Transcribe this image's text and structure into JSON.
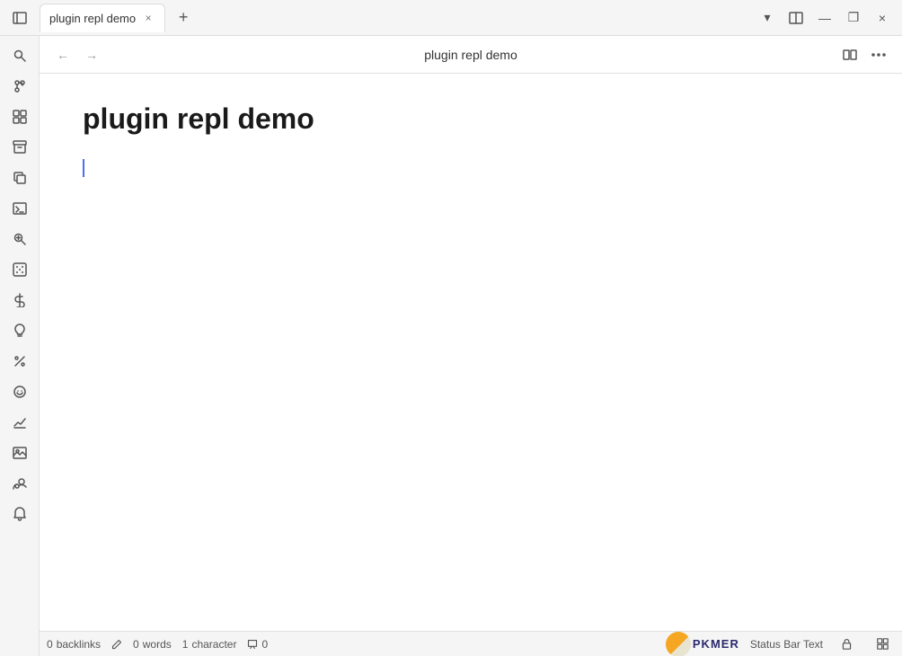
{
  "titleBar": {
    "tab_label": "plugin repl demo",
    "close_label": "×",
    "new_tab_label": "+",
    "sidebar_toggle_icon": "sidebar-icon",
    "dropdown_icon": "▾",
    "split_icon": "⊞",
    "minimize_icon": "—",
    "restore_icon": "❐",
    "window_close_icon": "×"
  },
  "toolbar": {
    "back_icon": "←",
    "forward_icon": "→",
    "title": "plugin repl demo",
    "read_mode_icon": "□□",
    "more_icon": "⋯"
  },
  "sidebar": {
    "icons": [
      {
        "name": "sidebar-item-search",
        "glyph": "🔍",
        "label": "Search"
      },
      {
        "name": "sidebar-item-git",
        "glyph": "⎇",
        "label": "Git"
      },
      {
        "name": "sidebar-item-blocks",
        "glyph": "⊞",
        "label": "Blocks"
      },
      {
        "name": "sidebar-item-archive",
        "glyph": "🗃",
        "label": "Archive"
      },
      {
        "name": "sidebar-item-copy",
        "glyph": "⧉",
        "label": "Copy"
      },
      {
        "name": "sidebar-item-terminal",
        "glyph": ">_",
        "label": "Terminal"
      },
      {
        "name": "sidebar-item-search2",
        "glyph": "🔍",
        "label": "Search2"
      },
      {
        "name": "sidebar-item-dice",
        "glyph": "🎲",
        "label": "Dice"
      },
      {
        "name": "sidebar-item-dollar",
        "glyph": "$",
        "label": "Dollar"
      },
      {
        "name": "sidebar-item-bulb",
        "glyph": "💡",
        "label": "Bulb"
      },
      {
        "name": "sidebar-item-percent",
        "glyph": "<%",
        "label": "Percent"
      },
      {
        "name": "sidebar-item-emoji",
        "glyph": "☺",
        "label": "Emoji"
      },
      {
        "name": "sidebar-item-chart",
        "glyph": "📈",
        "label": "Chart"
      },
      {
        "name": "sidebar-item-image",
        "glyph": "🖼",
        "label": "Image"
      },
      {
        "name": "sidebar-item-user",
        "glyph": "👤",
        "label": "User"
      },
      {
        "name": "sidebar-item-bell",
        "glyph": "🔔",
        "label": "Bell"
      }
    ]
  },
  "editor": {
    "doc_title": "plugin repl demo",
    "cursor_visible": true
  },
  "statusBar": {
    "backlinks_count": "0",
    "backlinks_label": "backlinks",
    "words_count": "0",
    "words_label": "words",
    "char_count": "1",
    "char_label": "character",
    "comments_count": "0",
    "status_bar_text": "Status Bar Text",
    "lock_icon": "🔒",
    "grid_icon": "⊞"
  }
}
